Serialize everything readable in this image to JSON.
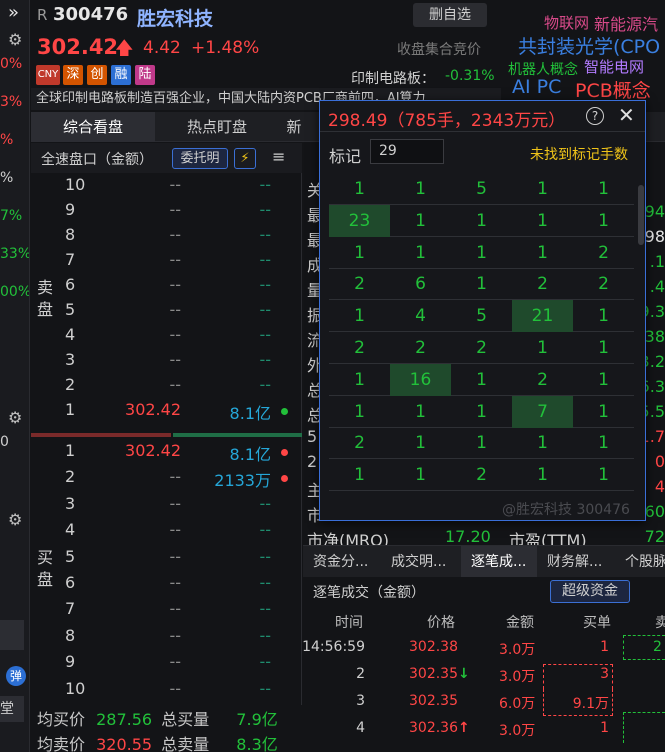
{
  "left_strip": {
    "menu_icon": "»",
    "values": [
      {
        "text": "0%",
        "color": "#ff4646"
      },
      {
        "text": "3%",
        "color": "#ff4646"
      },
      {
        "text": "%",
        "color": "#ff4646"
      },
      {
        "text": "%",
        "color": "#cfcfcf"
      },
      {
        "text": "7%",
        "color": "#22c03a"
      },
      {
        "text": "33%",
        "color": "#22c03a"
      },
      {
        "text": "00%",
        "color": "#22c03a"
      },
      {
        "text": "0",
        "color": "#cfcfcf"
      },
      {
        "text": "弹",
        "color": "#ffffff"
      },
      {
        "text": "堂",
        "color": "#cfcfcf"
      }
    ]
  },
  "header": {
    "code_prefix": "R",
    "code": "300476",
    "name": "胜宏科技",
    "watch_button": "删自选",
    "price": "302.42",
    "change": "4.42",
    "change_pct": "+1.48%",
    "auction_text": "收盘集合竞价",
    "tags": [
      {
        "text": "CNY",
        "bg": "#c0392b"
      },
      {
        "text": "深",
        "bg": "#d35400"
      },
      {
        "text": "创",
        "bg": "#d35400"
      },
      {
        "text": "融",
        "bg": "#2c6fd4"
      },
      {
        "text": "陆",
        "bg": "#c0398a"
      }
    ],
    "sector_label": "印制电路板：",
    "sector_pct": "-0.31%",
    "description": "全球印制电路板制造百强企业，中国大陆内资PCB厂商前四，AI算力"
  },
  "word_cloud": [
    {
      "text": "物联网",
      "color": "#d94a8a",
      "size": 15
    },
    {
      "text": "新能源汽",
      "color": "#d94a8a",
      "size": 16
    },
    {
      "text": "共封装光学(CPO",
      "color": "#3a7fe0",
      "size": 19
    },
    {
      "text": "机器人概念",
      "color": "#22c03a",
      "size": 14
    },
    {
      "text": "智能电网",
      "color": "#b27bff",
      "size": 15
    },
    {
      "text": "AI PC",
      "color": "#3a7fe0",
      "size": 19
    },
    {
      "text": "PCB概念",
      "color": "#ff4646",
      "size": 19
    }
  ],
  "tabs": [
    "综合看盘",
    "热点盯盘",
    "新"
  ],
  "order_book": {
    "title": "全速盘口（金额）",
    "entrust_button": "委托明",
    "bolt_icon": "⚡",
    "menu_icon": "≡",
    "sell_label": "卖\n盘",
    "buy_label": "买\n盘",
    "sell_rows": [
      {
        "level": "10",
        "price": "--",
        "volume": "--"
      },
      {
        "level": "9",
        "price": "--",
        "volume": "--"
      },
      {
        "level": "8",
        "price": "--",
        "volume": "--"
      },
      {
        "level": "7",
        "price": "--",
        "volume": "--"
      },
      {
        "level": "6",
        "price": "--",
        "volume": "--"
      },
      {
        "level": "5",
        "price": "--",
        "volume": "--"
      },
      {
        "level": "4",
        "price": "--",
        "volume": "--"
      },
      {
        "level": "3",
        "price": "--",
        "volume": "--"
      },
      {
        "level": "2",
        "price": "--",
        "volume": "--"
      },
      {
        "level": "1",
        "price": "302.42",
        "volume": "8.1亿"
      }
    ],
    "buy_rows": [
      {
        "level": "1",
        "price": "302.42",
        "volume": "8.1亿"
      },
      {
        "level": "2",
        "price": "--",
        "volume": "2133万"
      },
      {
        "level": "3",
        "price": "--",
        "volume": "--"
      },
      {
        "level": "4",
        "price": "--",
        "volume": "--"
      },
      {
        "level": "5",
        "price": "--",
        "volume": "--"
      },
      {
        "level": "6",
        "price": "--",
        "volume": "--"
      },
      {
        "level": "7",
        "price": "--",
        "volume": "--"
      },
      {
        "level": "8",
        "price": "--",
        "volume": "--"
      },
      {
        "level": "9",
        "price": "--",
        "volume": "--"
      },
      {
        "level": "10",
        "price": "--",
        "volume": "--"
      }
    ],
    "avg_buy_label": "均买价",
    "avg_buy": "287.56",
    "total_buy_label": "总买量",
    "total_buy": "7.9亿",
    "avg_sell_label": "均卖价",
    "avg_sell": "320.55",
    "total_sell_label": "总卖量",
    "total_sell": "8.3亿"
  },
  "right_panel": {
    "rows": [
      {
        "label": "关",
        "value": "",
        "color": "#cfcfcf"
      },
      {
        "label": "最",
        "value": "94",
        "color": "#22c03a"
      },
      {
        "label": "最",
        "value": "98",
        "color": "#e6e6e6"
      },
      {
        "label": "成",
        "value": ".1",
        "color": "#22c03a"
      },
      {
        "label": "量",
        "value": ".4",
        "color": "#22c03a"
      },
      {
        "label": "振",
        "value": "9.3",
        "color": "#22c03a"
      },
      {
        "label": "流",
        "value": "38",
        "color": "#22c03a"
      },
      {
        "label": "外",
        "value": "3.2",
        "color": "#22c03a"
      },
      {
        "label": "总",
        "value": "6.3",
        "color": "#22c03a"
      },
      {
        "label": "总",
        "value": "5.5",
        "color": "#22c03a"
      },
      {
        "label": "5",
        "value": "1.7",
        "color": "#ff4646"
      },
      {
        "label": "2",
        "value": "0",
        "color": "#ff4646"
      },
      {
        "label": "主",
        "value": "4",
        "color": "#ff4646"
      },
      {
        "label": "市",
        "value": "60",
        "color": "#22c03a"
      },
      {
        "label": "市净(MRQ)",
        "mid": "17.20",
        "mid_label": "市盈(TTM)",
        "value": "72",
        "color": "#22c03a"
      }
    ]
  },
  "bottom_tabs": [
    "资金分...",
    "成交明...",
    "逐笔成...",
    "财务解...",
    "个股脉"
  ],
  "trades": {
    "title": "逐笔成交（金额）",
    "super_button": "超级资金",
    "columns": [
      "时间",
      "价格",
      "金额",
      "买单",
      "卖"
    ],
    "rows": [
      {
        "time": "14:56:59",
        "price": "302.38",
        "arrow": "",
        "amount": "3.0万",
        "buy": "1",
        "sell": "2"
      },
      {
        "time": "2",
        "price": "302.35",
        "arrow": "↓",
        "amount": "3.0万",
        "buy": "3",
        "sell": ""
      },
      {
        "time": "3",
        "price": "302.35",
        "arrow": "",
        "amount": "6.0万",
        "buy": "9.1万",
        "sell": ""
      },
      {
        "time": "4",
        "price": "302.36",
        "arrow": "↑",
        "amount": "3.0万",
        "buy": "1",
        "sell": ""
      }
    ]
  },
  "popup": {
    "title": "298.49（785手，2343万元）",
    "help_icon": "?",
    "close_icon": "✕",
    "mark_label": "标记",
    "mark_value": "29",
    "not_found": "未找到标记手数",
    "grid": [
      [
        "1",
        "1",
        "5",
        "1",
        "1"
      ],
      [
        "23",
        "1",
        "1",
        "1",
        "1"
      ],
      [
        "1",
        "1",
        "1",
        "1",
        "2"
      ],
      [
        "2",
        "6",
        "1",
        "2",
        "2"
      ],
      [
        "1",
        "4",
        "5",
        "21",
        "1"
      ],
      [
        "2",
        "2",
        "2",
        "1",
        "1"
      ],
      [
        "1",
        "16",
        "1",
        "2",
        "1"
      ],
      [
        "1",
        "1",
        "1",
        "7",
        "1"
      ],
      [
        "2",
        "1",
        "1",
        "1",
        "1"
      ],
      [
        "1",
        "1",
        "2",
        "1",
        "1"
      ]
    ],
    "highlight": [
      "23",
      "21",
      "16",
      "7"
    ],
    "watermark": "@胜宏科技 300476"
  }
}
